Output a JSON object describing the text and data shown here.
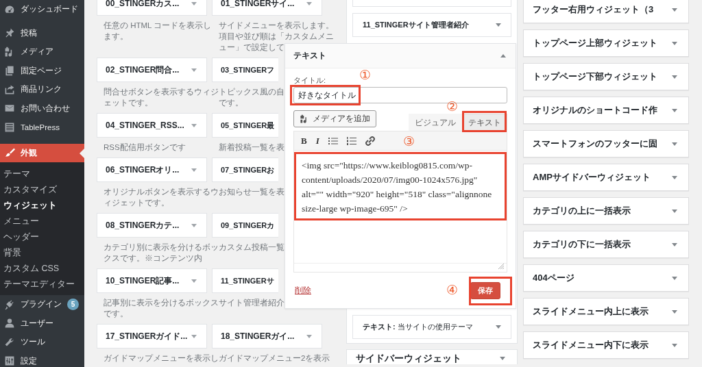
{
  "sidebar": {
    "items": [
      {
        "label": "ダッシュボード",
        "selected": false
      },
      {
        "label": "投稿",
        "selected": false
      },
      {
        "label": "メディア",
        "selected": false
      },
      {
        "label": "固定ページ",
        "selected": false
      },
      {
        "label": "商品リンク",
        "selected": false
      },
      {
        "label": "お問い合わせ",
        "selected": false
      },
      {
        "label": "TablePress",
        "selected": false
      },
      {
        "label": "外観",
        "selected": true,
        "children": [
          {
            "label": "テーマ",
            "selected": false
          },
          {
            "label": "カスタマイズ",
            "selected": false
          },
          {
            "label": "ウィジェット",
            "selected": true
          },
          {
            "label": "メニュー",
            "selected": false
          },
          {
            "label": "ヘッダー",
            "selected": false
          },
          {
            "label": "背景",
            "selected": false
          },
          {
            "label": "カスタム CSS",
            "selected": false
          },
          {
            "label": "テーマエディター",
            "selected": false
          }
        ]
      },
      {
        "label": "プラグイン",
        "selected": false,
        "badge": "5"
      },
      {
        "label": "ユーザー",
        "selected": false
      },
      {
        "label": "ツール",
        "selected": false
      },
      {
        "label": "設定",
        "selected": false
      }
    ]
  },
  "available_widgets": {
    "rows": [
      {
        "cells": [
          {
            "title": "00_STINGERカス...",
            "description_lines": [
              "任意の HTML コードを表示し",
              "ます。"
            ]
          },
          {
            "title": "01_STINGERサイ...",
            "description_lines": [
              "サイドメニューを表示します。",
              "項目や並び順は「カスタムメニ",
              "ュー」で設定して"
            ]
          }
        ]
      },
      {
        "cells": [
          {
            "title": "02_STINGER問合...",
            "description_lines": [
              "問合せボタンを表示するウィジ",
              "ェットです。"
            ]
          },
          {
            "title": "03_STINGERフ",
            "description_lines": [
              "トピックス風の自",
              "です。"
            ]
          }
        ]
      },
      {
        "cells": [
          {
            "title": "04_STINGER_RSS...",
            "description_lines": [
              "RSS配信用ボタンです"
            ]
          },
          {
            "title": "05_STINGER最",
            "description_lines": [
              "新着投稿一覧を表"
            ]
          }
        ]
      },
      {
        "cells": [
          {
            "title": "06_STINGERオリ...",
            "description_lines": [
              "オリジナルボタンを表示するウ",
              "ィジェットです。"
            ]
          },
          {
            "title": "07_STINGERお",
            "description_lines": [
              "お知らせ一覧を表"
            ]
          }
        ]
      },
      {
        "cells": [
          {
            "title": "08_STINGERカテ...",
            "description_lines": [
              "カテゴリ別に表示を分けるボッ",
              "クスです。※コンテンツ内"
            ]
          },
          {
            "title": "09_STINGERカ",
            "description_lines": [
              "カスタム投稿一覧"
            ]
          }
        ]
      },
      {
        "cells": [
          {
            "title": "10_STINGER記事...",
            "description_lines": [
              "記事別に表示を分けるボックス",
              "です。"
            ]
          },
          {
            "title": "11_STINGERサ",
            "description_lines": [
              "サイト管理者紹介"
            ]
          }
        ]
      },
      {
        "cells": [
          {
            "title": "17_STINGERガイド...",
            "description_lines": [
              "ガイドマップメニューを表示し"
            ]
          },
          {
            "title": "18_STINGERガイ...",
            "description_lines": [
              "ガイドマップメニュー2を表示"
            ]
          }
        ]
      }
    ]
  },
  "widget_area": {
    "widgets": [
      {
        "title": "11_STINGERサイト管理者紹介",
        "expanded": false
      },
      {
        "title": "テキスト",
        "expanded": true,
        "form": {
          "title_label": "タイトル:",
          "title_value": "好きなタイトル",
          "media_button": "メディアを追加",
          "tabs": [
            {
              "label": "ビジュアル",
              "selected": false
            },
            {
              "label": "テキスト",
              "selected": true
            }
          ],
          "toolbar": [
            {
              "kind": "bold",
              "label": "B"
            },
            {
              "kind": "italic",
              "label": "I"
            },
            {
              "kind": "bullets"
            },
            {
              "kind": "numbers"
            },
            {
              "kind": "link"
            }
          ],
          "content": "<img src=\"https://www.keiblog0815.com/wp-content/uploads/2020/07/img00-1024x576.jpg\" alt=\"\" width=\"920\" height=\"518\" class=\"alignnone size-large wp-image-695\" />",
          "delete_link": "削除",
          "save_button": "保存",
          "annotations": [
            {
              "number": "①"
            },
            {
              "number": "②"
            },
            {
              "number": "③"
            },
            {
              "number": "④"
            }
          ]
        }
      },
      {
        "title": "**テキスト:** 当サイトの使用テーマ",
        "expanded": false
      }
    ]
  },
  "next_area": {
    "title": "サイドバーウィジェット"
  },
  "right_area": {
    "widgets": [
      {
        "title": "フッター右用ウィジェット（3"
      },
      {
        "title": "トップページ上部ウィジェット"
      },
      {
        "title": "トップページ下部ウィジェット"
      },
      {
        "title": "オリジナルのショートコード作"
      },
      {
        "title": "スマートフォンのフッターに固"
      },
      {
        "title": "AMPサイドバーウィジェット"
      },
      {
        "title": "カテゴリの上に一括表示"
      },
      {
        "title": "カテゴリの下に一括表示"
      },
      {
        "title": "404ページ"
      },
      {
        "title": "スライドメニュー内上に表示"
      },
      {
        "title": "スライドメニュー内下に表示"
      }
    ]
  }
}
